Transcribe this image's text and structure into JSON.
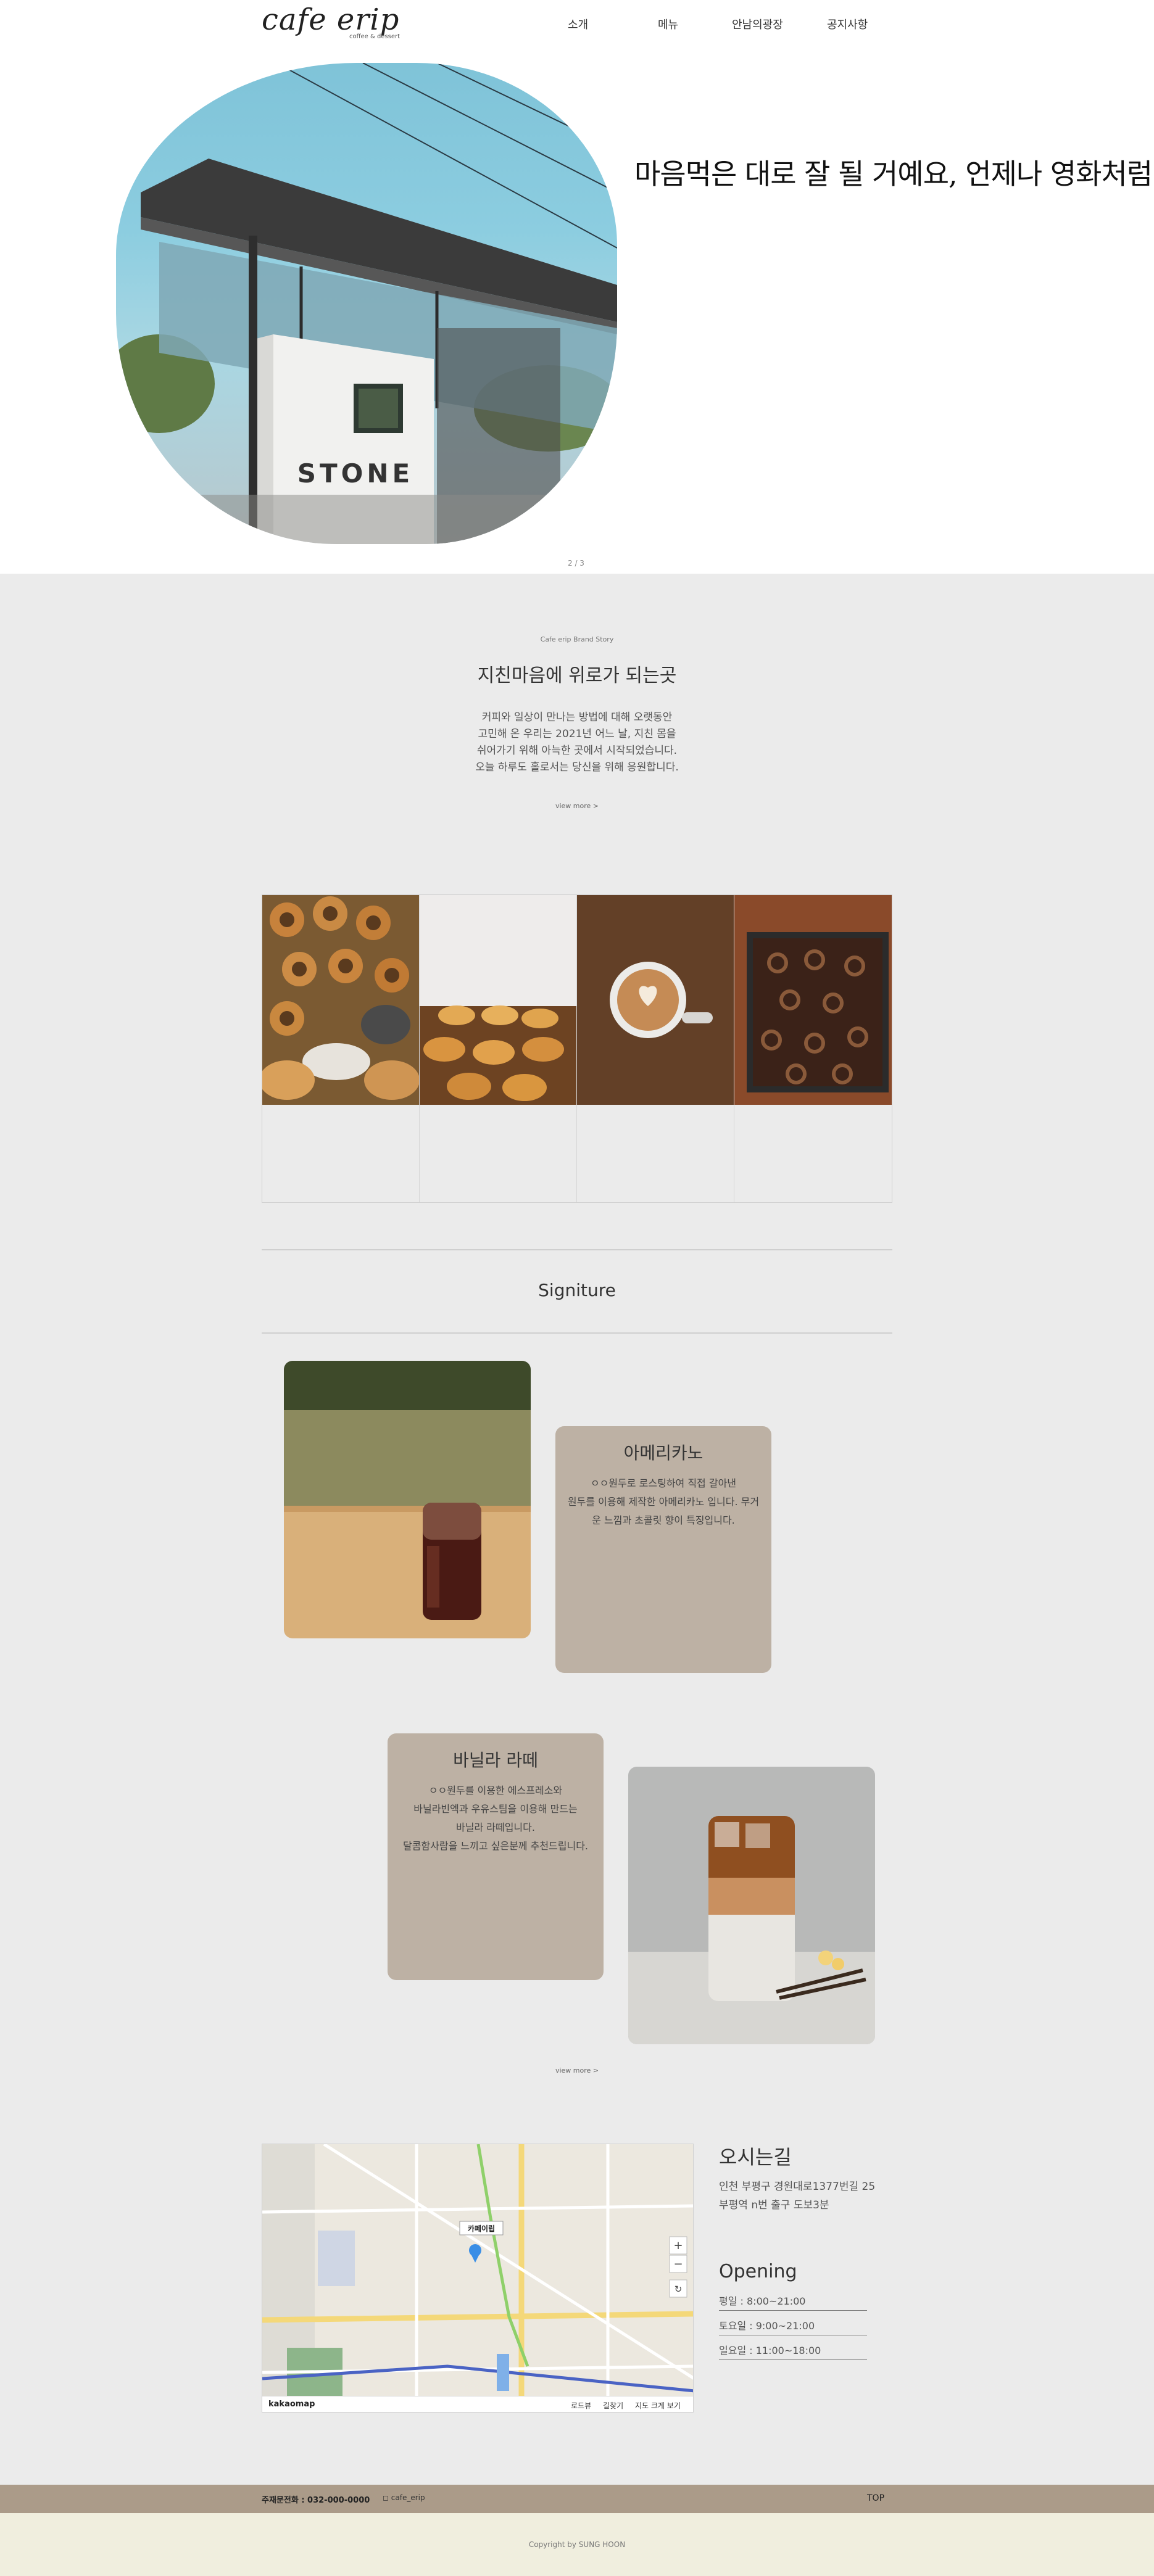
{
  "header": {
    "logo": "cafe erip",
    "logo_sub": "coffee & dessert",
    "nav": [
      "소개",
      "메뉴",
      "안남의광장",
      "공지사항"
    ]
  },
  "hero": {
    "sign_text": "STONE",
    "slogan": "마음먹은 대로 잘 될 거예요, 언제나 영화처럼",
    "pager": "2 / 3"
  },
  "brand": {
    "tag": "Cafe erip Brand Story",
    "title": "지친마음에 위로가 되는곳",
    "body": [
      "커피와 일상이 만나는 방법에 대해 오랫동안",
      "고민해 온 우리는 2021년 어느 날, 지친 몸을",
      "쉬어가기 위해 아늑한 곳에서 시작되었습니다.",
      "오늘 하루도 홀로서는 당신을 위해 응원합니다."
    ],
    "more": "view more >"
  },
  "gallery": {
    "items": [
      "baked-goods-tray",
      "madeleines-on-table",
      "latte-art-cup",
      "brownie-pan"
    ]
  },
  "signature": {
    "title": "Signiture",
    "menu1": {
      "name": "아메리카노",
      "desc": [
        "ㅇㅇ원두로 로스팅하여 직접 갈아낸",
        "원두를 이용해 제작한 아메리카노 입니다. 무거",
        "운 느낌과 초콜릿 향이 특징입니다."
      ]
    },
    "menu2": {
      "name": "바닐라 라떼",
      "desc": [
        "ㅇㅇ원두를 이용한 에스프레소와",
        "바닐라빈엑과 우유스팀을 이용해 만드는",
        "바닐라 라떼입니다.",
        "달콤함사람을 느끼고 싶은분께 추천드립니다."
      ]
    },
    "more": "view more >"
  },
  "map": {
    "marker_label": "카페이립",
    "brand": "kakaomap",
    "links": [
      "로드뷰",
      "길찾기",
      "지도 크게 보기"
    ]
  },
  "info": {
    "name": "오시는길",
    "address1": "인천 부평구 경원대로1377번길 25",
    "address2": "부평역 n번 출구 도보3분",
    "opening_title": "Opening",
    "hours": [
      "평일 : 8:00~21:00",
      "토요일 : 9:00~21:00",
      "일요일 : 11:00~18:00"
    ]
  },
  "footer": {
    "phone": "주재문전화 : 032-000-0000",
    "insta": "cafe_erip",
    "top": "TOP",
    "copyright": "Copyright by SUNG HOON"
  },
  "colors": {
    "section_bg": "#ebebeb",
    "card_bg": "#bdb1a4",
    "footer_bar": "#ab9b89",
    "footer_bottom": "#f0eede"
  }
}
